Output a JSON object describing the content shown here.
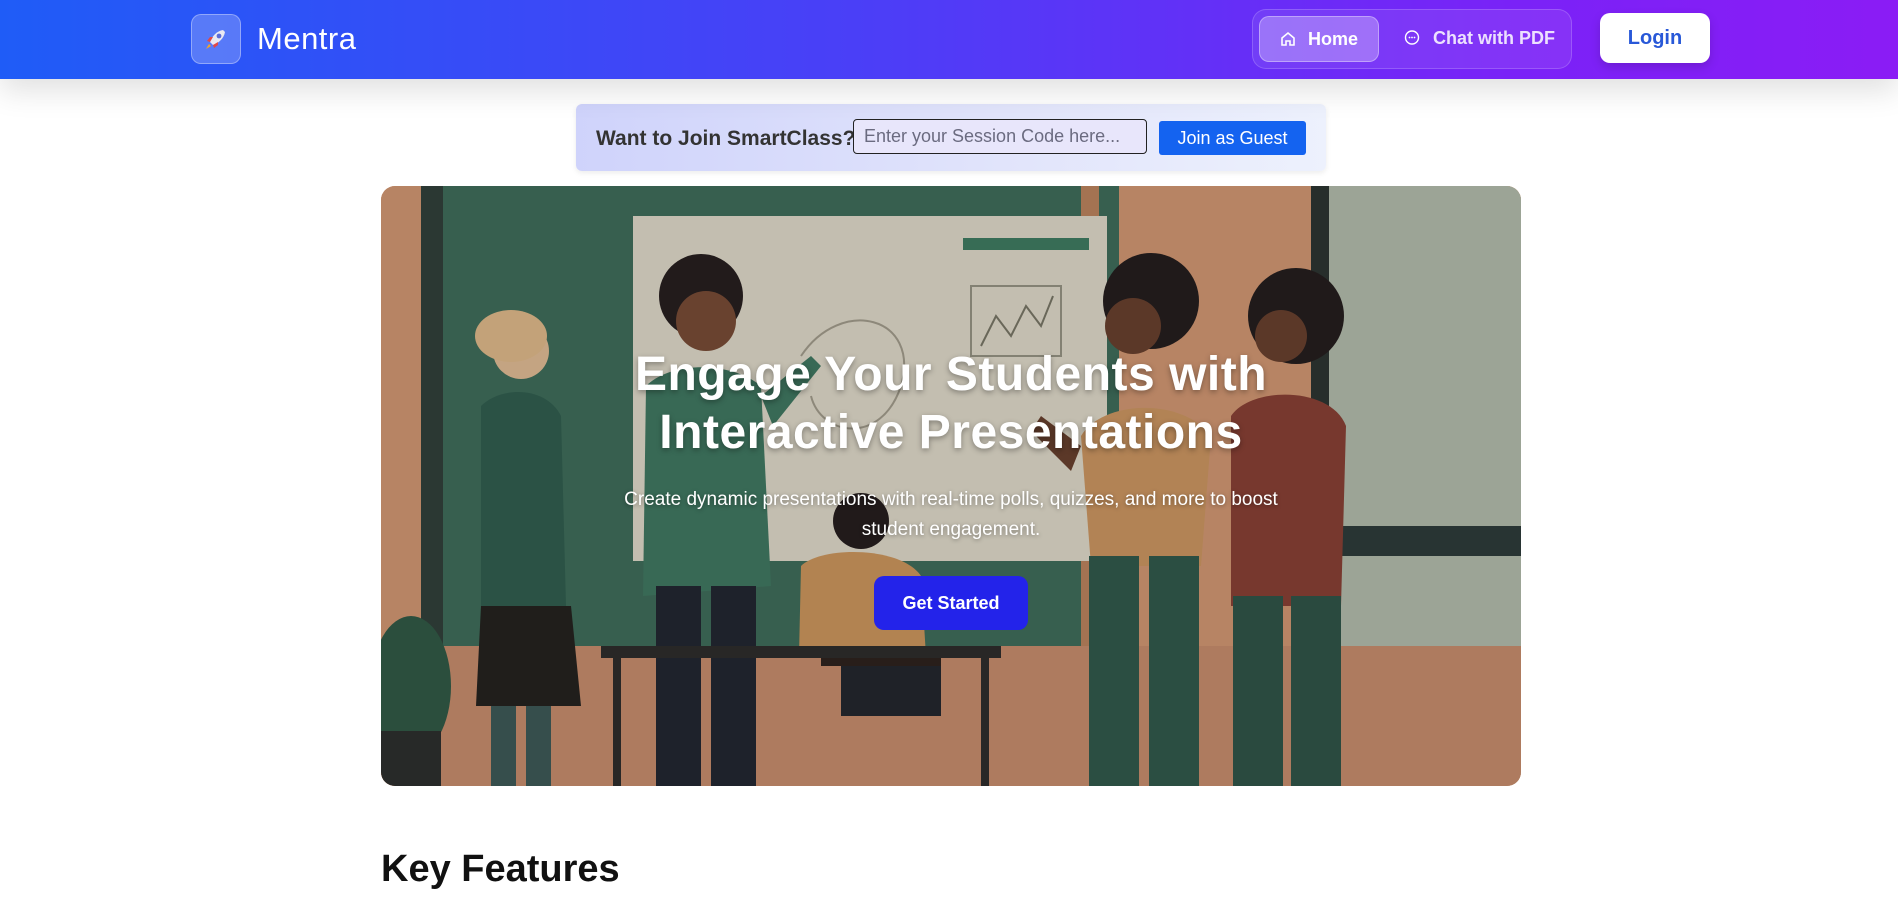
{
  "navbar": {
    "brand_name": "Mentra",
    "brand_icon": "rocket-icon",
    "nav_items": [
      {
        "label": "Home",
        "icon": "home-icon",
        "active": true
      },
      {
        "label": "Chat with PDF",
        "icon": "chat-icon",
        "active": false
      }
    ],
    "login_label": "Login"
  },
  "join": {
    "label": "Want to Join SmartClass?",
    "input_placeholder": "Enter your Session Code here...",
    "input_value": "",
    "button_label": "Join as Guest"
  },
  "hero": {
    "title_line1": "Engage Your Students with",
    "title_line2": "Interactive Presentations",
    "subtitle": "Create dynamic presentations with real-time polls, quizzes, and more to boost student engagement.",
    "cta_label": "Get Started",
    "image": "classroom-illustration"
  },
  "features": {
    "title": "Key Features"
  },
  "colors": {
    "nav_gradient_start": "#1f5cf7",
    "nav_gradient_end": "#8b1cf5",
    "join_button": "#1463f0",
    "cta_button": "#2323ea",
    "login_text": "#2858d8"
  }
}
